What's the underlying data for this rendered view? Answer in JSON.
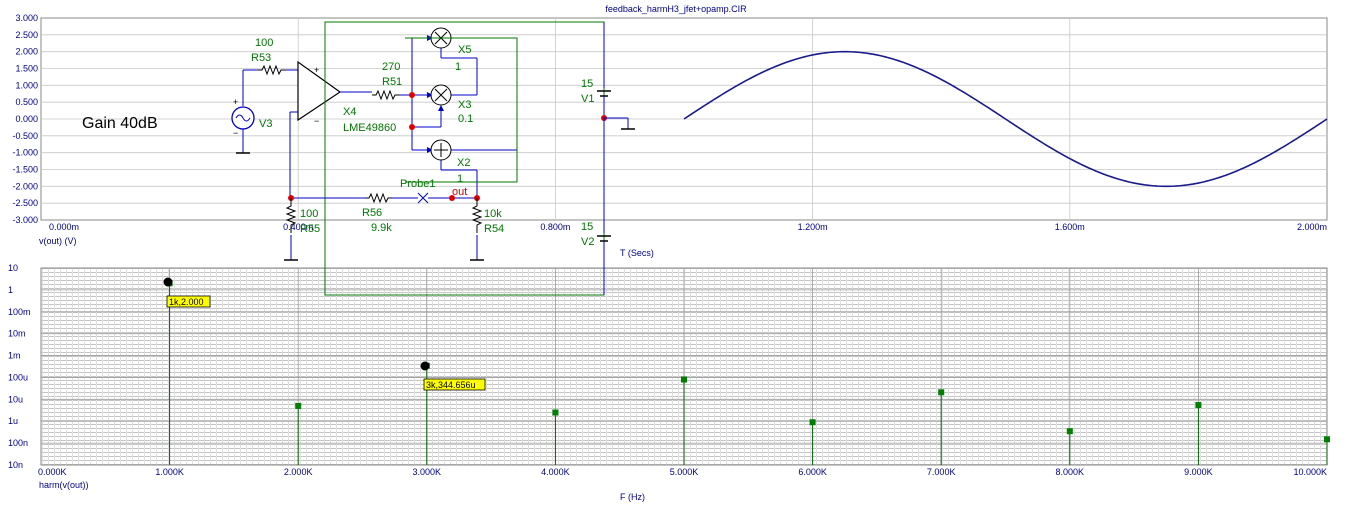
{
  "window": {
    "title": "feedback_harmH3_jfet+opamp.CIR"
  },
  "schematic": {
    "gain_text": "Gain 40dB",
    "r53_value": "100",
    "r53_name": "R53",
    "r51_value": "270",
    "r51_name": "R51",
    "r55_value": "100",
    "r55_name": "R55",
    "r56_name": "R56",
    "r56_value": "9.9k",
    "r54_value": "10k",
    "r54_name": "R54",
    "v3_name": "V3",
    "x4_name": "X4",
    "x4_part": "LME49860",
    "x5_name": "X5",
    "x5_gain": "1",
    "x3_name": "X3",
    "x3_gain": "0.1",
    "x2_name": "X2",
    "x2_gain": "1",
    "probe_name": "Probe1",
    "out_label": "out",
    "v1_value": "15",
    "v1_name": "V1",
    "v2_value": "15",
    "v2_name": "V2",
    "plus_sign": "+",
    "minus_sign": "−"
  },
  "transient_plot": {
    "trace_label": "v(out) (V)",
    "x_axis_label": "T (Secs)",
    "y_ticks": [
      "3.000",
      "2.500",
      "2.000",
      "1.500",
      "1.000",
      "0.500",
      "0.000",
      "-0.500",
      "-1.000",
      "-1.500",
      "-2.000",
      "-2.500",
      "-3.000"
    ],
    "x_ticks": [
      "0.000m",
      "0.400m",
      "0.800m",
      "1.200m",
      "1.600m",
      "2.000m"
    ]
  },
  "harmonic_plot": {
    "trace_label": "harm(v(out))",
    "x_axis_label": "F (Hz)",
    "y_ticks": [
      "10",
      "1",
      "100m",
      "10m",
      "1m",
      "100u",
      "10u",
      "1u",
      "100n",
      "10n"
    ],
    "x_ticks": [
      "0.000K",
      "1.000K",
      "2.000K",
      "3.000K",
      "4.000K",
      "5.000K",
      "6.000K",
      "7.000K",
      "8.000K",
      "9.000K",
      "10.000K"
    ],
    "cursor1_label": "1k,2.000",
    "cursor2_label": "3k,344.656u"
  },
  "chart_data": [
    {
      "type": "line",
      "xlabel": "T (Secs)",
      "ylabel": "v(out) (V)",
      "xlim": [
        0,
        0.002
      ],
      "ylim": [
        -3,
        3
      ],
      "grid": true,
      "series": [
        {
          "name": "v(out)",
          "shape": "sine",
          "amplitude": 2.0,
          "frequency_hz": 1000,
          "visible_from_s": 0.001,
          "visible_to_s": 0.002
        }
      ]
    },
    {
      "type": "bar",
      "xlabel": "F (Hz)",
      "ylabel": "harm(v(out))",
      "xlim": [
        0,
        10000
      ],
      "ylim": [
        1e-08,
        10
      ],
      "y_scale": "log",
      "grid": true,
      "series": [
        {
          "name": "harm(v(out))",
          "x": [
            1000,
            2000,
            3000,
            4000,
            5000,
            6000,
            7000,
            8000,
            9000,
            10000
          ],
          "values": [
            2.0,
            5e-06,
            0.000344656,
            2.5e-06,
            8e-05,
            9e-07,
            2.1e-05,
            3.5e-07,
            5.5e-06,
            1.5e-07
          ]
        }
      ]
    }
  ]
}
